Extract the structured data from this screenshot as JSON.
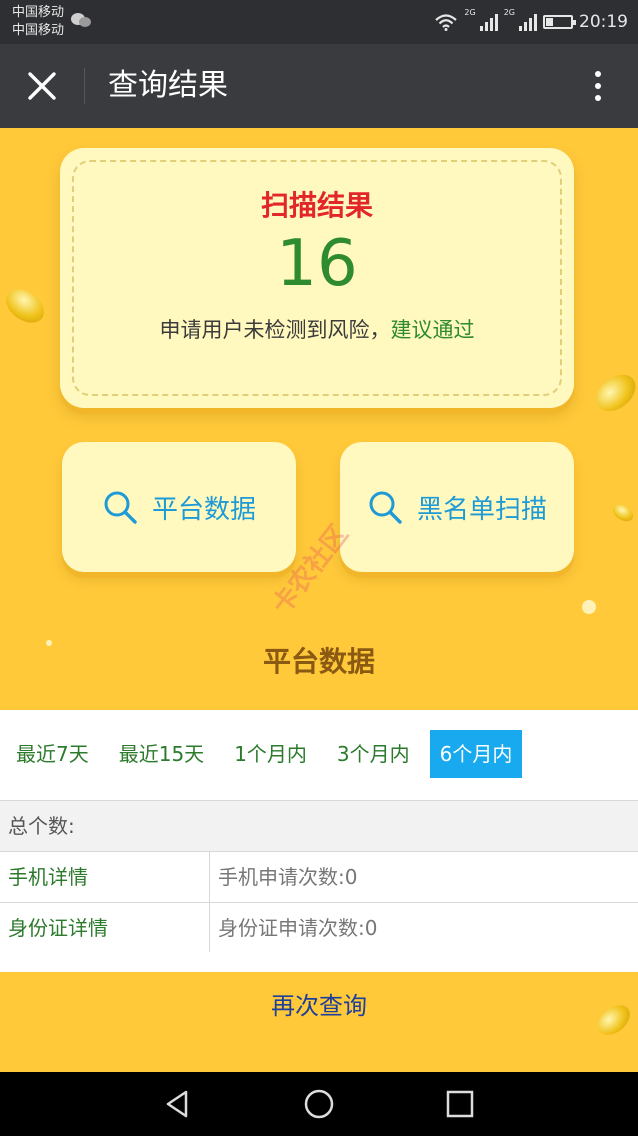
{
  "status_bar": {
    "carrier_1": "中国移动",
    "carrier_2": "中国移动",
    "network_1": "2G",
    "network_2": "2G",
    "time": "20:19",
    "icons": [
      "wechat-icon",
      "wifi-icon",
      "signal-icon",
      "battery-icon"
    ]
  },
  "title_bar": {
    "title": "查询结果",
    "icons": [
      "close-icon",
      "more-vertical-icon"
    ]
  },
  "result": {
    "title": "扫描结果",
    "score": "16",
    "desc_prefix": "申请用户未检测到风险，",
    "desc_advice": "建议通过"
  },
  "actions": [
    {
      "label": "平台数据",
      "icon": "search-icon"
    },
    {
      "label": "黑名单扫描",
      "icon": "search-icon"
    }
  ],
  "watermark": "卡农社区",
  "section_title": "平台数据",
  "tabs": [
    {
      "label": "最近7天",
      "active": false
    },
    {
      "label": "最近15天",
      "active": false
    },
    {
      "label": "1个月内",
      "active": false
    },
    {
      "label": "3个月内",
      "active": false
    },
    {
      "label": "6个月内",
      "active": true
    }
  ],
  "table": {
    "header": "总个数:",
    "rows": [
      {
        "key": "手机详情",
        "value": "手机申请次数:0"
      },
      {
        "key": "身份证详情",
        "value": "身份证申请次数:0"
      }
    ]
  },
  "requery_label": "再次查询",
  "nav_bar": {
    "icons": [
      "back-icon",
      "home-icon",
      "recents-icon"
    ]
  },
  "colors": {
    "background": "#ffc93a",
    "card": "#fff8bf",
    "score": "#2e8b2e",
    "result_title": "#e3262a",
    "action_text": "#1e9bd7",
    "tab_active": "#18a9ee"
  }
}
